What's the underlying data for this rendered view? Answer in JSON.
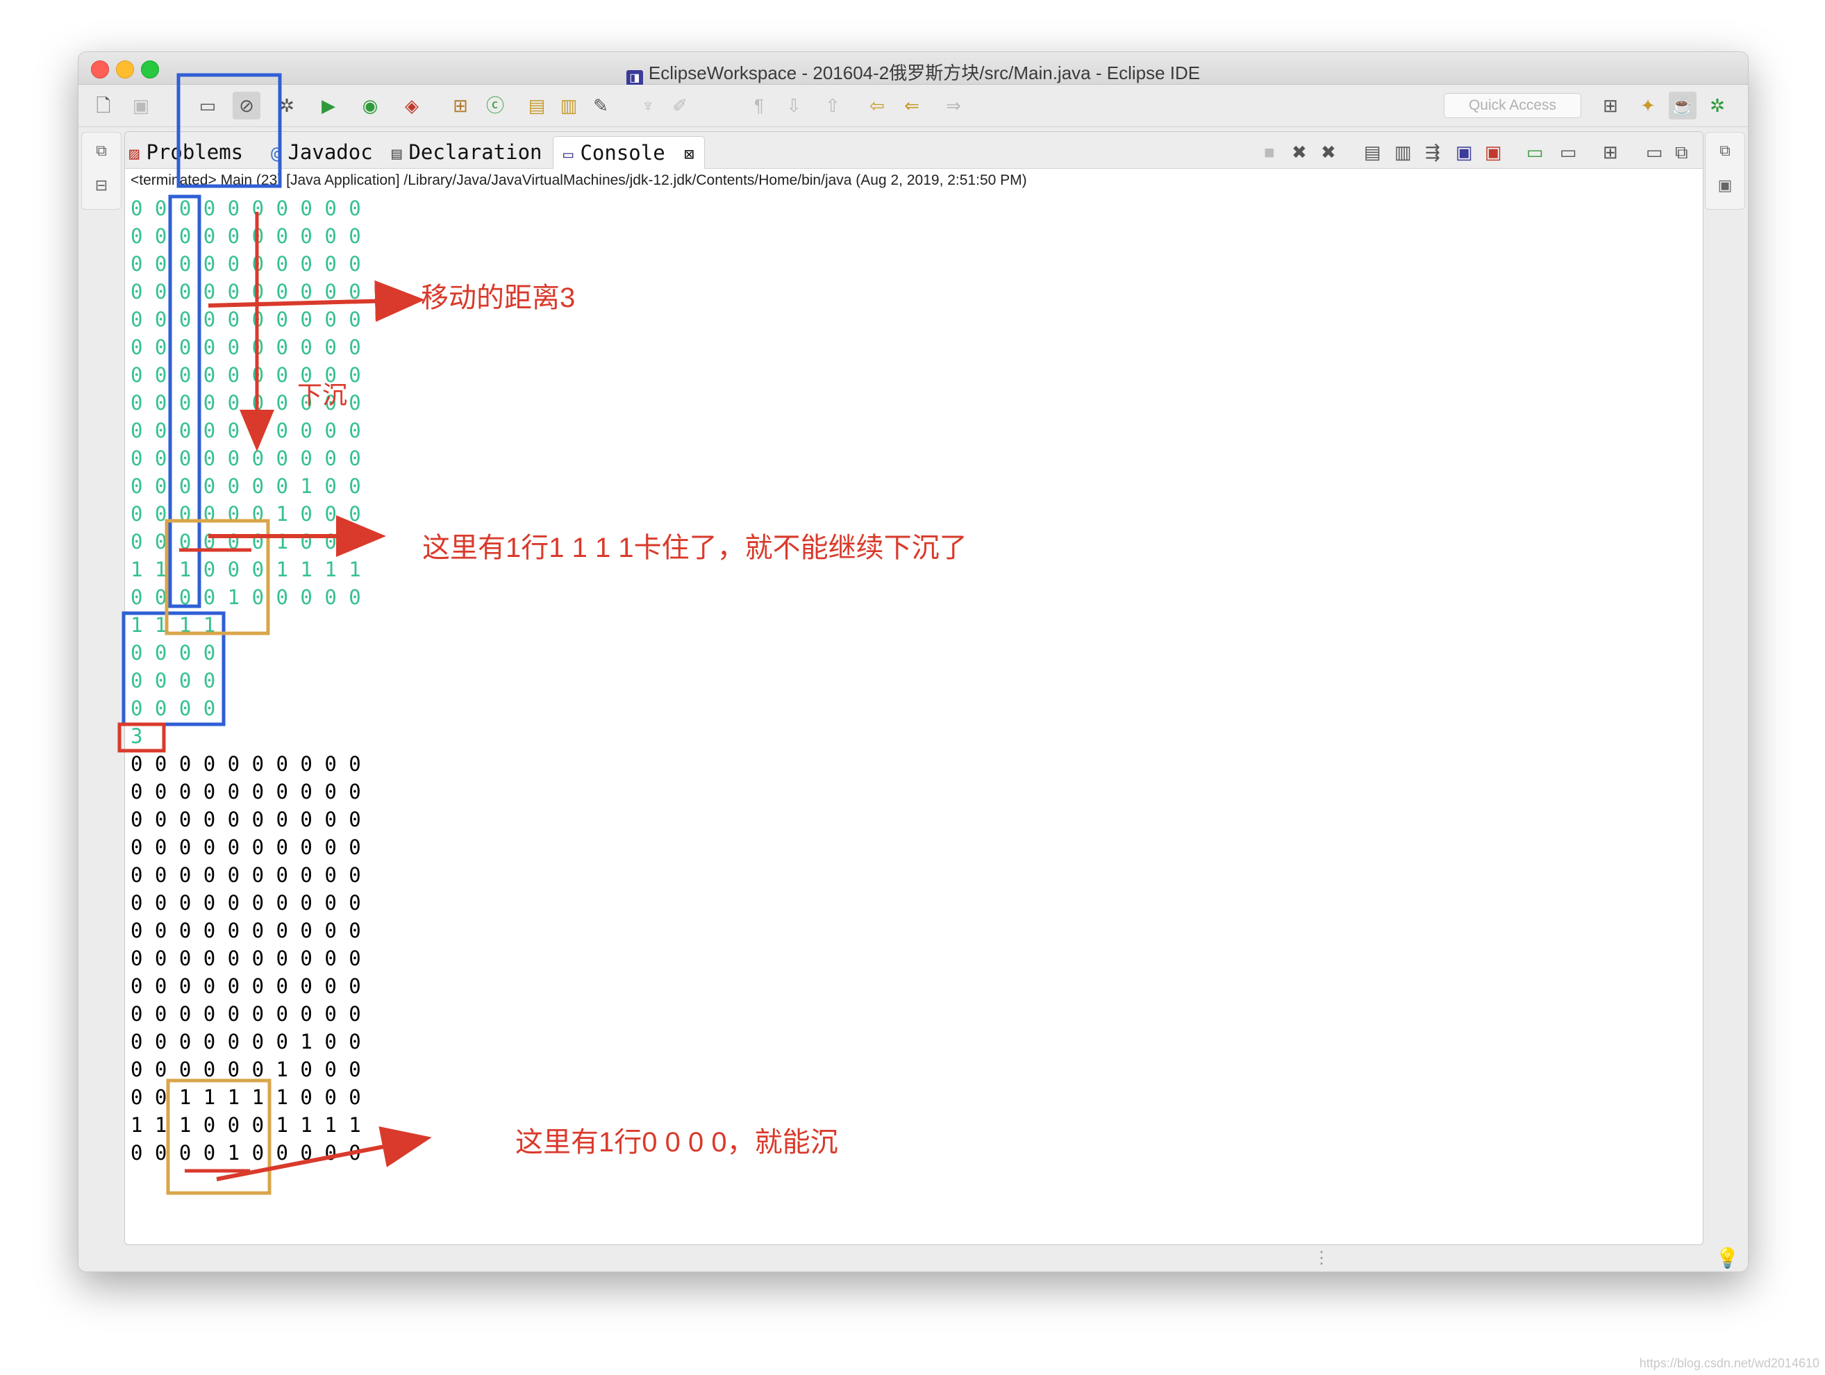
{
  "window": {
    "title": "EclipseWorkspace - 201604-2俄罗斯方块/src/Main.java - Eclipse IDE"
  },
  "toolbar": {
    "quick_access_placeholder": "Quick Access"
  },
  "tabs": [
    {
      "label": "Problems",
      "icon": "problems-icon"
    },
    {
      "label": "Javadoc",
      "icon": "javadoc-icon"
    },
    {
      "label": "Declaration",
      "icon": "declaration-icon"
    },
    {
      "label": "Console",
      "icon": "console-icon",
      "active": true
    }
  ],
  "console": {
    "header": "<terminated> Main (23) [Java Application] /Library/Java/JavaVirtualMachines/jdk-12.jdk/Contents/Home/bin/java (Aug 2, 2019, 2:51:50 PM)",
    "input_grid": [
      "0 0 0 0 0 0 0 0 0 0",
      "0 0 0 0 0 0 0 0 0 0",
      "0 0 0 0 0 0 0 0 0 0",
      "0 0 0 0 0 0 0 0 0 0",
      "0 0 0 0 0 0 0 0 0 0",
      "0 0 0 0 0 0 0 0 0 0",
      "0 0 0 0 0 0 0 0 0 0",
      "0 0 0 0 0 0 0 0 0 0",
      "0 0 0 0 0 0 0 0 0 0",
      "0 0 0 0 0 0 0 0 0 0",
      "0 0 0 0 0 0 0 1 0 0",
      "0 0 0 0 0 0 1 0 0 0",
      "0 0 0 0 0 0 1 0 0 0",
      "1 1 1 0 0 0 1 1 1 1",
      "0 0 0 0 1 0 0 0 0 0"
    ],
    "block_grid": [
      "1 1 1 1",
      "0 0 0 0",
      "0 0 0 0",
      "0 0 0 0"
    ],
    "column": "3",
    "output_grid": [
      "0 0 0 0 0 0 0 0 0 0",
      "0 0 0 0 0 0 0 0 0 0",
      "0 0 0 0 0 0 0 0 0 0",
      "0 0 0 0 0 0 0 0 0 0",
      "0 0 0 0 0 0 0 0 0 0",
      "0 0 0 0 0 0 0 0 0 0",
      "0 0 0 0 0 0 0 0 0 0",
      "0 0 0 0 0 0 0 0 0 0",
      "0 0 0 0 0 0 0 0 0 0",
      "0 0 0 0 0 0 0 0 0 0",
      "0 0 0 0 0 0 0 1 0 0",
      "0 0 0 0 0 0 1 0 0 0",
      "0 0 1 1 1 1 1 0 0 0",
      "1 1 1 0 0 0 1 1 1 1",
      "0 0 0 0 1 0 0 0 0 0"
    ]
  },
  "annotations": {
    "move_distance": "移动的距离3",
    "sink": "下沉",
    "blocked": "这里有1行1 1 1 1卡住了，就不能继续下沉了",
    "can_sink": "这里有1行0 0 0 0，就能沉"
  },
  "watermark": "https://blog.csdn.net/wd2014610",
  "colors": {
    "console_green": "#35c18f",
    "annotation_red": "#d93a2b",
    "highlight_blue": "#2f5fd6",
    "highlight_gold": "#d9a54a"
  }
}
